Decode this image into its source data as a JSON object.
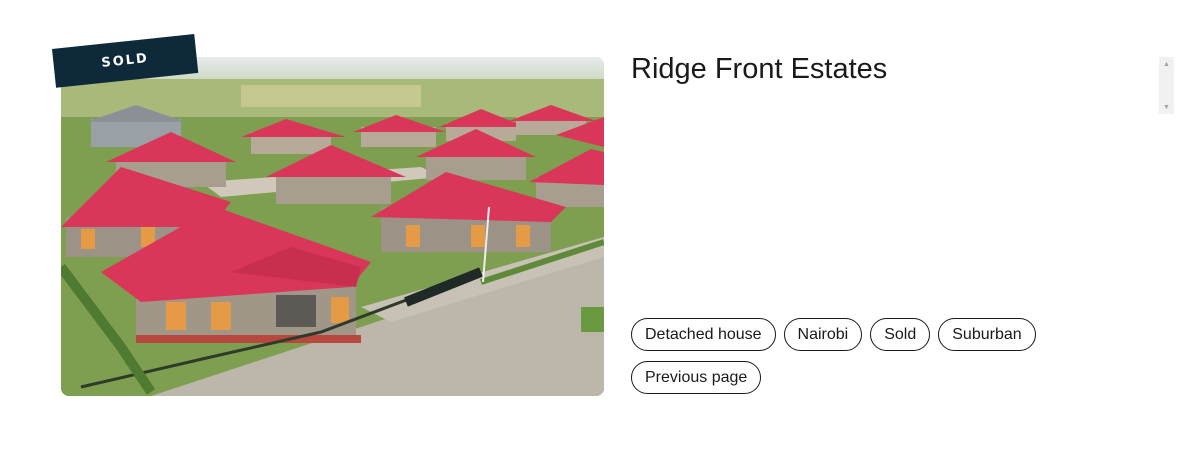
{
  "listing": {
    "title": "Ridge Front Estates",
    "status_ribbon": "SOLD",
    "photo_alt": "Aerial view of red-roofed bungalows in a gated estate"
  },
  "tags": [
    {
      "label": "Detached house"
    },
    {
      "label": "Nairobi"
    },
    {
      "label": "Sold"
    },
    {
      "label": "Suburban"
    },
    {
      "label": "Previous page"
    }
  ],
  "scrollbar": {
    "up_icon": "triangle-up",
    "down_icon": "triangle-down"
  },
  "colors": {
    "ribbon_bg": "#0e2a3a",
    "roof": "#d9365a",
    "text": "#1a1a1a"
  }
}
